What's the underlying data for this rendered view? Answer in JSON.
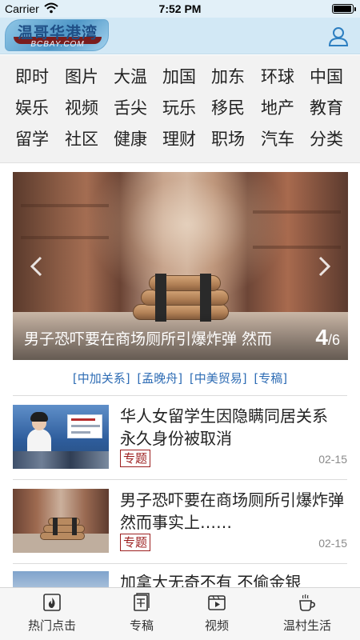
{
  "status_bar": {
    "carrier": "Carrier",
    "time": "7:52 PM",
    "battery_level": 0.95
  },
  "header": {
    "logo_text_cn": "温哥华港湾",
    "logo_text_en": "BCBAY.COM",
    "user_icon": "user-profile-icon"
  },
  "categories": [
    [
      "即时",
      "图片",
      "大温",
      "加国",
      "加东",
      "环球",
      "中国"
    ],
    [
      "娱乐",
      "视频",
      "舌尖",
      "玩乐",
      "移民",
      "地产",
      "教育"
    ],
    [
      "留学",
      "社区",
      "健康",
      "理财",
      "职场",
      "汽车",
      "分类"
    ]
  ],
  "carousel": {
    "title": "男子恐吓要在商场厕所引爆炸弹 然而",
    "current": "4",
    "separator": "/",
    "total": "6",
    "prev_icon": "chevron-left-icon",
    "next_icon": "chevron-right-icon"
  },
  "tags": [
    "[中加关系]",
    "[孟晚舟]",
    "[中美贸易]",
    "[专稿]"
  ],
  "news": [
    {
      "title": "华人女留学生因隐瞒同居关系 永久身份被取消",
      "badge": "专题",
      "date": "02-15"
    },
    {
      "title": "男子恐吓要在商场厕所引爆炸弹 然而事实上……",
      "badge": "专题",
      "date": "02-15"
    },
    {
      "title": "加拿大无奇不有 不偷金银"
    }
  ],
  "tab_bar": [
    {
      "label": "热门点击",
      "icon": "flame-icon"
    },
    {
      "label": "专稿",
      "icon": "article-icon"
    },
    {
      "label": "视频",
      "icon": "video-icon"
    },
    {
      "label": "温村生活",
      "icon": "coffee-cup-icon"
    }
  ],
  "colors": {
    "header_bg": "#d2e8f5",
    "tag_link": "#2f6db5",
    "badge": "#9c1f1f",
    "date": "#8a8a8a"
  }
}
